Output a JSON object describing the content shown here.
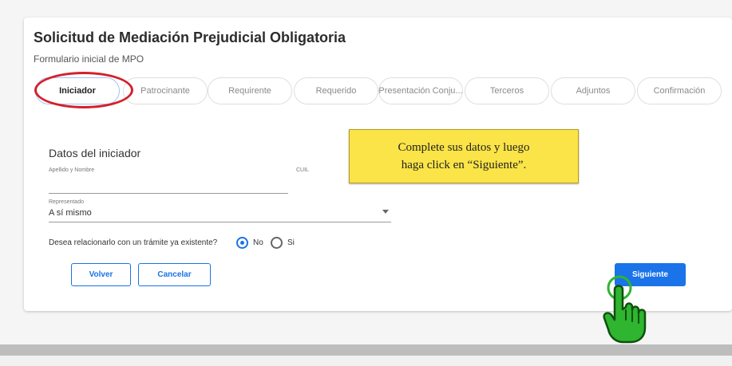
{
  "form": {
    "title": "Solicitud de Mediación Prejudicial Obligatoria",
    "subtitle": "Formulario inicial de MPO"
  },
  "steps": [
    {
      "label": "Iniciador",
      "active": true
    },
    {
      "label": "Patrocinante",
      "active": false
    },
    {
      "label": "Requirente",
      "active": false
    },
    {
      "label": "Requerido",
      "active": false
    },
    {
      "label": "Presentación Conju...",
      "active": false
    },
    {
      "label": "Terceros",
      "active": false
    },
    {
      "label": "Adjuntos",
      "active": false
    },
    {
      "label": "Confirmación",
      "active": false
    }
  ],
  "section": {
    "title": "Datos del iniciador",
    "apellido_label": "Apellido y Nombre",
    "apellido_value": "",
    "cuil_label": "CUIL",
    "cuil_value": "",
    "representado_label": "Representado",
    "representado_value": "A sí mismo"
  },
  "question": {
    "text": "Desea relacionarlo con un trámite ya existente?",
    "options": [
      {
        "label": "No",
        "selected": true
      },
      {
        "label": "Si",
        "selected": false
      }
    ]
  },
  "buttons": {
    "volver": "Volver",
    "cancelar": "Cancelar",
    "siguiente": "Siguiente"
  },
  "callout": {
    "line1": "Complete sus datos y luego",
    "line2": "haga click en “Siguiente”."
  },
  "colors": {
    "accent": "#1a73e8",
    "highlight_ring": "#d4202a",
    "callout_bg": "#fbe447",
    "hand_green": "#2fb52f"
  },
  "icons": {
    "pointer": "hand-pointer-icon"
  }
}
